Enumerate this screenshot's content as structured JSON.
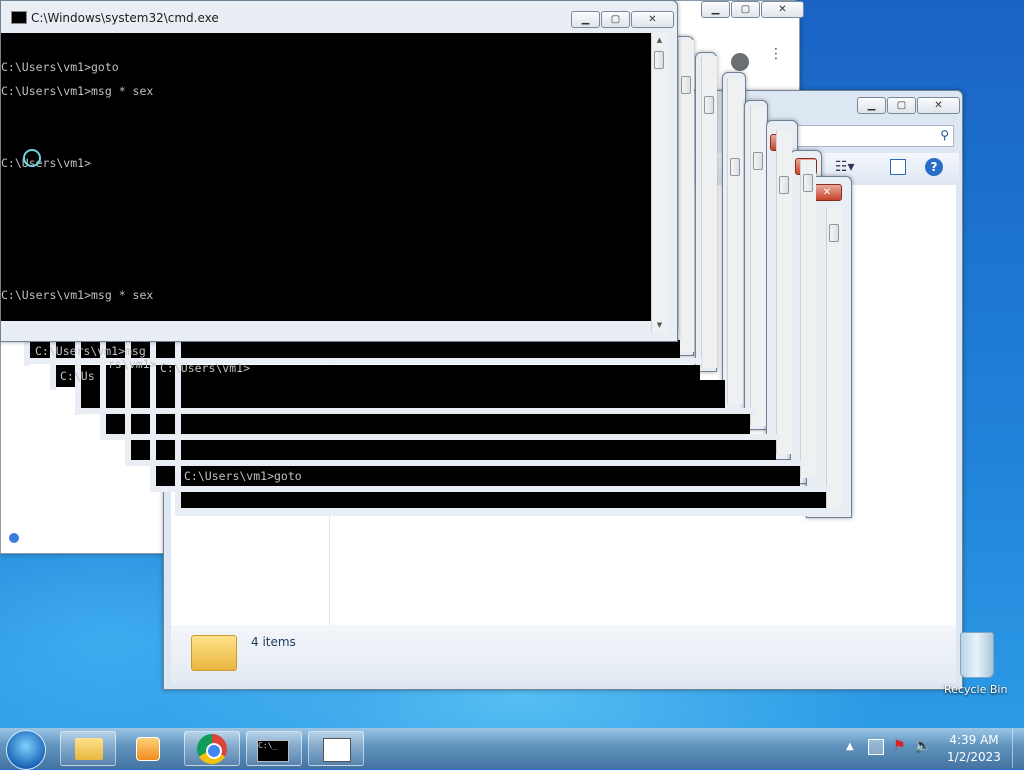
{
  "console": {
    "title": "C:\\Windows\\system32\\cmd.exe",
    "lines": [
      "C:\\Users\\vm1>goto",
      "C:\\Users\\vm1>msg * sex",
      "C:\\Users\\vm1>",
      "C:\\Users\\vm1>msg * sex"
    ],
    "stacked_fragments": [
      "C:",
      "C:",
      "C:\\Users\\vm1>msg",
      "C:\\Us",
      "rs\\vm1>",
      "C:\\Users\\vm1>",
      "C:\\Users\\vm1>goto"
    ]
  },
  "window_buttons": {
    "minimize": "▁",
    "maximize": "▢",
    "close": "✕"
  },
  "explorer": {
    "status_count": "4 items"
  },
  "desktop": {
    "recycle_bin_label": "Recycle Bin"
  },
  "taskbar": {
    "time": "4:39 AM",
    "date": "1/2/2023",
    "apps": [
      "start-orb-icon",
      "folder-icon",
      "media-player-icon",
      "chrome-icon",
      "cmd-icon",
      "window-icon"
    ]
  },
  "colors": {
    "console_bg": "#000000",
    "console_text": "#c0c0c0",
    "taskbar": "#6d9ccb"
  }
}
